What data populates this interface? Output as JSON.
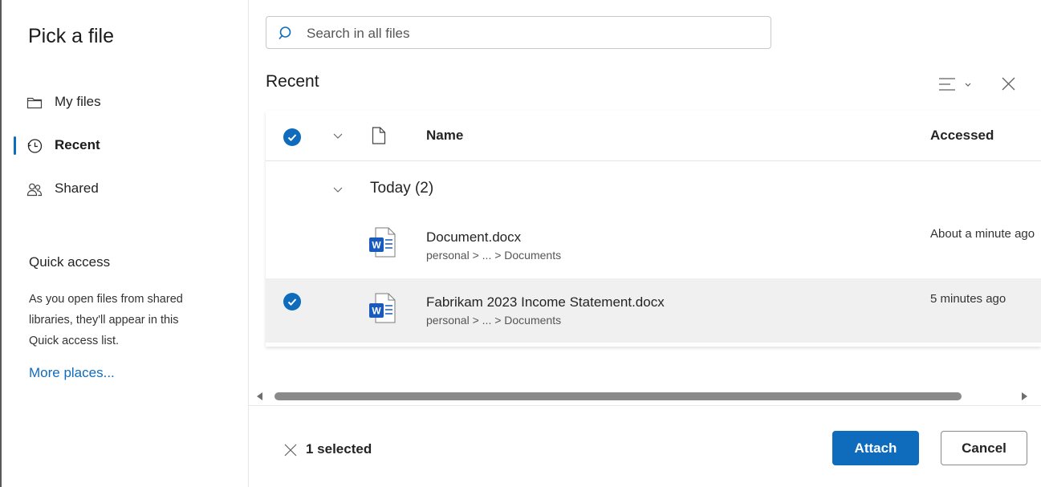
{
  "sidebar": {
    "title": "Pick a file",
    "nav": [
      {
        "label": "My files",
        "icon": "folder-icon"
      },
      {
        "label": "Recent",
        "icon": "clock-icon",
        "active": true
      },
      {
        "label": "Shared",
        "icon": "people-icon"
      }
    ],
    "quick_access": {
      "title": "Quick access",
      "lines": [
        "As you open files from shared",
        "libraries, they'll appear in this",
        "Quick access list."
      ],
      "more_places": "More places..."
    }
  },
  "search": {
    "placeholder": "Search in all files",
    "value": ""
  },
  "main": {
    "section_title": "Recent",
    "columns": {
      "name": "Name",
      "accessed": "Accessed"
    },
    "group": {
      "label": "Today (2)"
    },
    "files": [
      {
        "name": "Document.docx",
        "path": "personal > ... > Documents",
        "accessed": "About a minute ago",
        "selected": false,
        "icon": "word-document-icon"
      },
      {
        "name": "Fabrikam 2023 Income Statement.docx",
        "path": "personal > ... > Documents",
        "accessed": "5 minutes ago",
        "selected": true,
        "icon": "word-document-icon"
      }
    ]
  },
  "footer": {
    "selected_count": "1 selected",
    "attach": "Attach",
    "cancel": "Cancel"
  },
  "colors": {
    "accent": "#0f6cbd",
    "selected_row": "#f0f0f0",
    "word_blue": "#185abd"
  }
}
